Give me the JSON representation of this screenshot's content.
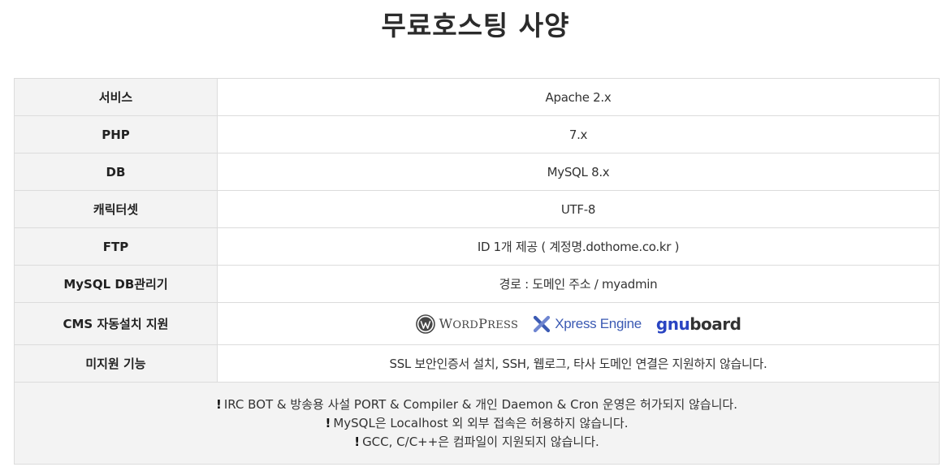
{
  "title": "무료호스팅 사양",
  "rows": [
    {
      "label": "서비스",
      "value": "Apache 2.x"
    },
    {
      "label": "PHP",
      "value": "7.x"
    },
    {
      "label": "DB",
      "value": "MySQL 8.x"
    },
    {
      "label": "캐릭터셋",
      "value": "UTF-8"
    },
    {
      "label": "FTP",
      "value": "ID 1개 제공 ( 계정명.dothome.co.kr )"
    },
    {
      "label": "MySQL DB관리기",
      "value": "경로 : 도메인 주소 / myadmin"
    }
  ],
  "cms": {
    "label": "CMS 자동설치 지원",
    "logos": {
      "wordpress_first": "W",
      "wordpress_rest": "ORD",
      "wordpress_second": "P",
      "wordpress_rest2": "RESS",
      "xe": "Xpress Engine",
      "gnu": "gnu",
      "board": "board"
    }
  },
  "unsupported": {
    "label": "미지원 기능",
    "value": "SSL 보안인증서 설치, SSH, 웹로그, 타사 도메인 연결은 지원하지 않습니다."
  },
  "notes": [
    {
      "mark": "!",
      "text": "IRC BOT & 방송용 사설 PORT & Compiler & 개인 Daemon & Cron 운영은 허가되지 않습니다."
    },
    {
      "mark": "!",
      "text": "MySQL은 Localhost 외 외부 접속은 허용하지 않습니다."
    },
    {
      "mark": "!",
      "text": "GCC, C/C++은 컴파일이 지원되지 않습니다."
    }
  ],
  "colors": {
    "label_bg": "#f3f3f3",
    "border": "#dcdcdc",
    "xe_blue": "#3b5ab3",
    "gnu_blue": "#2a45c2"
  }
}
